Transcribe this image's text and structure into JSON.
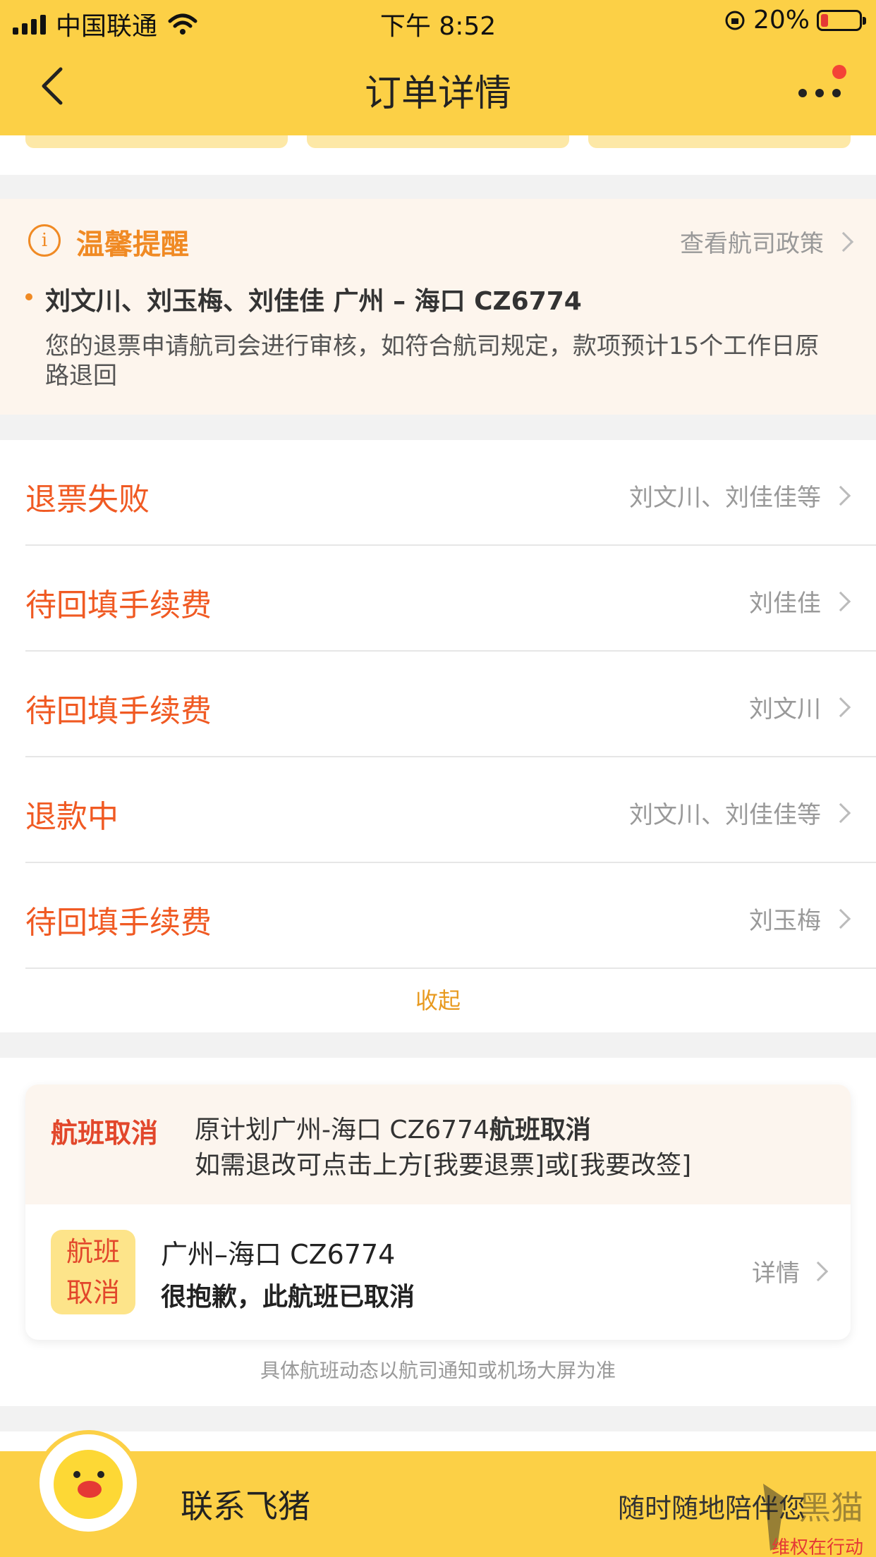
{
  "status_bar": {
    "carrier": "中国联通",
    "time": "下午 8:52",
    "battery": "20%",
    "battery_level": 0.2
  },
  "nav": {
    "title": "订单详情"
  },
  "reminder": {
    "title": "温馨提醒",
    "policy_link": "查看航司政策",
    "passengers_route": "刘文川、刘玉梅、刘佳佳 广州 – 海口 CZ6774",
    "message": "您的退票申请航司会进行审核，如符合航司规定，款项预计15个工作日原路退回"
  },
  "status_list": {
    "items": [
      {
        "status": "退票失败",
        "names": "刘文川、刘佳佳等"
      },
      {
        "status": "待回填手续费",
        "names": "刘佳佳"
      },
      {
        "status": "待回填手续费",
        "names": "刘文川"
      },
      {
        "status": "退款中",
        "names": "刘文川、刘佳佳等"
      },
      {
        "status": "待回填手续费",
        "names": "刘玉梅"
      }
    ],
    "collapse_label": "收起"
  },
  "flight": {
    "notice_tag": "航班取消",
    "notice_line1_prefix": "原计划广州-海口 CZ6774",
    "notice_line1_bold": "航班取消",
    "notice_line2": "如需退改可点击上方[我要退票]或[我要改签]",
    "badge_line1": "航班",
    "badge_line2": "取消",
    "route": "广州–海口 CZ6774",
    "message": "很抱歉，此航班已取消",
    "detail_link": "详情",
    "footnote": "具体航班动态以航司通知或机场大屏为准"
  },
  "bottom": {
    "contact_label": "联系飞猪",
    "tagline": "随时随地陪伴您",
    "watermark": "维权在行动"
  },
  "colors": {
    "brand_yellow": "#fcd046",
    "accent_orange": "#f05a23",
    "reminder_orange": "#f08a24",
    "cancel_red": "#e2472b"
  }
}
